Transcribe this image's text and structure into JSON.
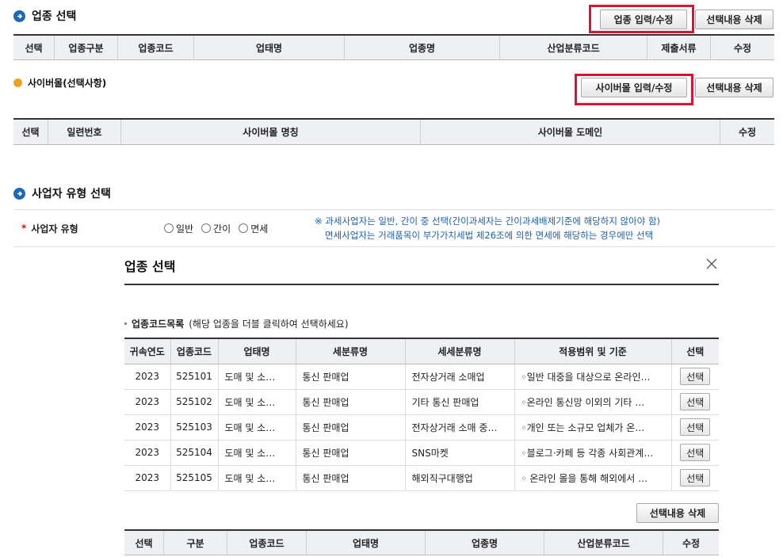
{
  "section1": {
    "title": "업종 선택",
    "btn_input": "업종 입력/수정",
    "btn_delete": "선택내용 삭제",
    "columns": [
      "선택",
      "업종구분",
      "업종코드",
      "업태명",
      "업종명",
      "산업분류코드",
      "제출서류",
      "수정"
    ]
  },
  "cyber": {
    "title": "사이버몰(선택사항)",
    "btn_input": "사이버몰 입력/수정",
    "btn_delete": "선택내용 삭제",
    "columns": [
      "선택",
      "일련번호",
      "사이버몰 명칭",
      "사이버몰 도메인",
      "수정"
    ]
  },
  "biztype": {
    "title": "사업자 유형 선택",
    "label": "사업자 유형",
    "required_mark": "*",
    "options": [
      "일반",
      "간이",
      "면세"
    ],
    "note_line1": "※ 과세사업자는 일반, 간이 중 선택(간이과세자는 간이과세배제기준에 해당하지 않아야 함)",
    "note_line2": "면세사업자는 거래품목이 부가가치세법 제26조에 의한 면세에 해당하는 경우에만 선택"
  },
  "modal": {
    "title": "업종 선택",
    "list_title": "업종코드목록",
    "list_hint": "(해당 업종을 더블 클릭하여 선택하세요)",
    "columns": [
      "귀속연도",
      "업종코드",
      "업태명",
      "세분류명",
      "세세분류명",
      "적용범위 및 기준",
      "선택"
    ],
    "rows": [
      [
        "2023",
        "525101",
        "도매 및 소…",
        "통신 판매업",
        "전자상거래 소매업",
        "◦일반 대중을 대상으로 온라인…",
        "선택"
      ],
      [
        "2023",
        "525102",
        "도매 및 소…",
        "통신 판매업",
        "기타 통신 판매업",
        "◦온라인 통신망 이외의 기타 …",
        "선택"
      ],
      [
        "2023",
        "525103",
        "도매 및 소…",
        "통신 판매업",
        "전자상거래 소매 중…",
        "◦개인 또는 소규모 업체가 온…",
        "선택"
      ],
      [
        "2023",
        "525104",
        "도매 및 소…",
        "통신 판매업",
        "SNS마켓",
        "◦블로그·카페 등 각종 사회관계…",
        "선택"
      ],
      [
        "2023",
        "525105",
        "도매 및 소…",
        "통신 판매업",
        "해외직구대행업",
        "◦ 온라인 몰을 통해 해외에서 …",
        "선택"
      ]
    ],
    "btn_delete": "선택내용 삭제",
    "bottom_columns": [
      "선택",
      "구분",
      "업종코드",
      "업태명",
      "업종명",
      "산업분류코드",
      "수정"
    ]
  },
  "colors": {
    "accent_blue": "#1b68b5",
    "highlight_red": "#e01030",
    "note_blue": "#1b5fa8",
    "bullet_orange": "#f0a020"
  }
}
